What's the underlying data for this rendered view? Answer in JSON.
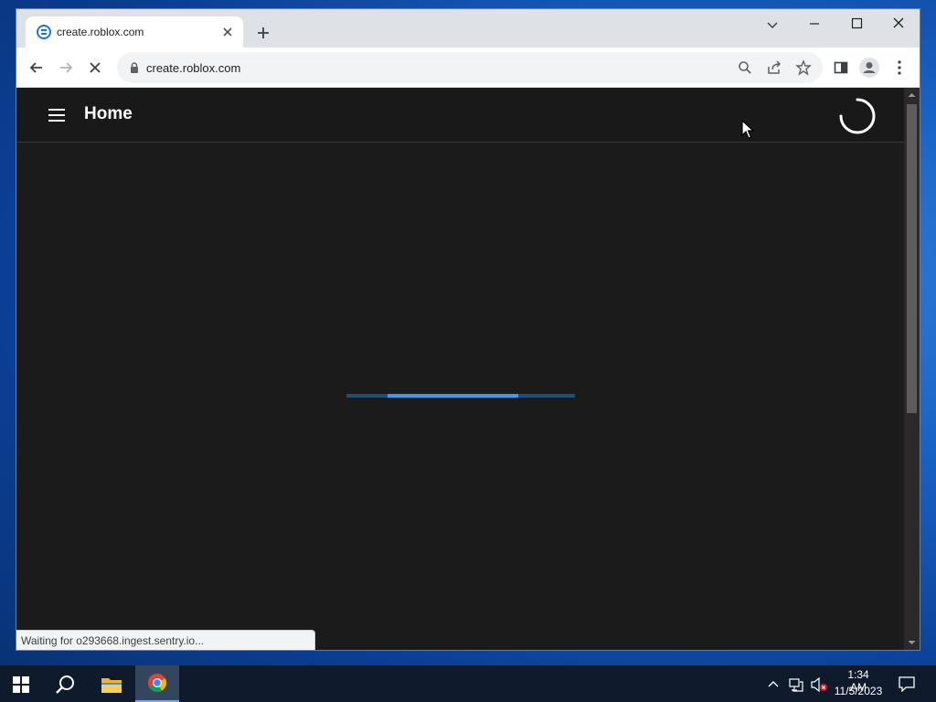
{
  "browser": {
    "tab": {
      "title": "create.roblox.com",
      "favicon": "roblox-studio-favicon"
    },
    "address_bar": {
      "url": "create.roblox.com"
    },
    "status_text": "Waiting for o293668.ingest.sentry.io..."
  },
  "page": {
    "title": "Home",
    "loading_progress": {
      "start": 0.18,
      "end": 0.75
    }
  },
  "taskbar": {
    "time": "1:34 AM",
    "date": "11/5/2023"
  },
  "colors": {
    "accent": "#3b9ee9",
    "page_background": "#1b1b1b",
    "taskbar": "#0f1a2d"
  },
  "icons": [
    "hamburger-icon",
    "spinner-icon",
    "back-icon",
    "forward-icon",
    "stop-icon",
    "lock-icon",
    "zoom-icon",
    "share-icon",
    "star-icon",
    "side-panel-icon",
    "profile-icon",
    "menu-icon",
    "windows-start-icon",
    "search-icon",
    "file-explorer-icon",
    "chrome-icon",
    "network-icon",
    "volume-muted-icon",
    "notification-icon"
  ]
}
